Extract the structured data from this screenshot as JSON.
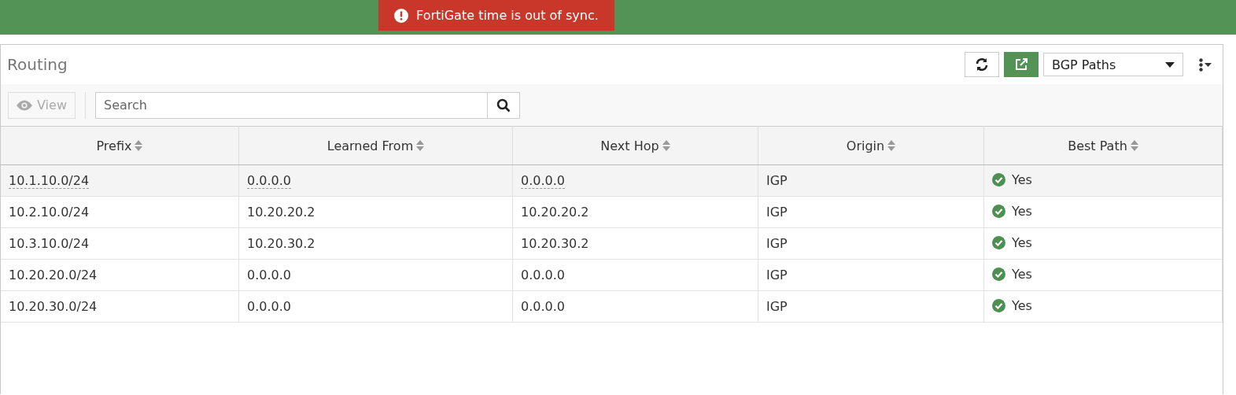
{
  "banner": {
    "message": "FortiGate time is out of sync."
  },
  "panel": {
    "title": "Routing",
    "view_selector": "BGP Paths"
  },
  "toolbar": {
    "view_button": {
      "label": "View",
      "disabled": true
    },
    "search": {
      "placeholder": "Search"
    }
  },
  "table": {
    "columns": [
      "Prefix",
      "Learned From",
      "Next Hop",
      "Origin",
      "Best Path"
    ],
    "rows": [
      {
        "selected": true,
        "cells": [
          "10.1.10.0/24",
          "0.0.0.0",
          "0.0.0.0",
          "IGP",
          "Yes"
        ]
      },
      {
        "selected": false,
        "cells": [
          "10.2.10.0/24",
          "10.20.20.2",
          "10.20.20.2",
          "IGP",
          "Yes"
        ]
      },
      {
        "selected": false,
        "cells": [
          "10.3.10.0/24",
          "10.20.30.2",
          "10.20.30.2",
          "IGP",
          "Yes"
        ]
      },
      {
        "selected": false,
        "cells": [
          "10.20.20.0/24",
          "0.0.0.0",
          "0.0.0.0",
          "IGP",
          "Yes"
        ]
      },
      {
        "selected": false,
        "cells": [
          "10.20.30.0/24",
          "0.0.0.0",
          "0.0.0.0",
          "IGP",
          "Yes"
        ]
      }
    ]
  }
}
